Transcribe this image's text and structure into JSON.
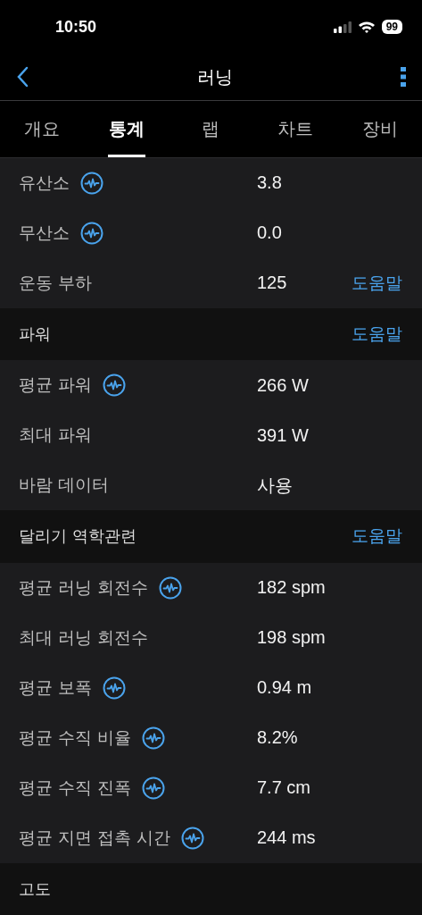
{
  "status_bar": {
    "time": "10:50",
    "battery": "99"
  },
  "nav": {
    "title": "러닝"
  },
  "tabs": [
    {
      "label": "개요",
      "selected": false
    },
    {
      "label": "통계",
      "selected": true
    },
    {
      "label": "랩",
      "selected": false
    },
    {
      "label": "차트",
      "selected": false
    },
    {
      "label": "장비",
      "selected": false
    }
  ],
  "sections": [
    {
      "rows": [
        {
          "label": "유산소",
          "value": "3.8",
          "chart_icon": true
        },
        {
          "label": "무산소",
          "value": "0.0",
          "chart_icon": true
        },
        {
          "label": "운동 부하",
          "value": "125",
          "chart_icon": false,
          "help": "도움말"
        }
      ]
    },
    {
      "title": "파워",
      "help": "도움말",
      "rows": [
        {
          "label": "평균 파워",
          "value": "266 W",
          "chart_icon": true
        },
        {
          "label": "최대 파워",
          "value": "391 W",
          "chart_icon": false
        },
        {
          "label": "바람 데이터",
          "value": "사용",
          "chart_icon": false
        }
      ]
    },
    {
      "title": "달리기 역학관련",
      "help": "도움말",
      "rows": [
        {
          "label": "평균 러닝 회전수",
          "value": "182 spm",
          "chart_icon": true
        },
        {
          "label": "최대 러닝 회전수",
          "value": "198 spm",
          "chart_icon": false
        },
        {
          "label": "평균 보폭",
          "value": "0.94 m",
          "chart_icon": true
        },
        {
          "label": "평균 수직 비율",
          "value": "8.2%",
          "chart_icon": true
        },
        {
          "label": "평균 수직 진폭",
          "value": "7.7 cm",
          "chart_icon": true
        },
        {
          "label": "평균 지면 접촉 시간",
          "value": "244 ms",
          "chart_icon": true
        }
      ]
    },
    {
      "title": "고도"
    }
  ]
}
